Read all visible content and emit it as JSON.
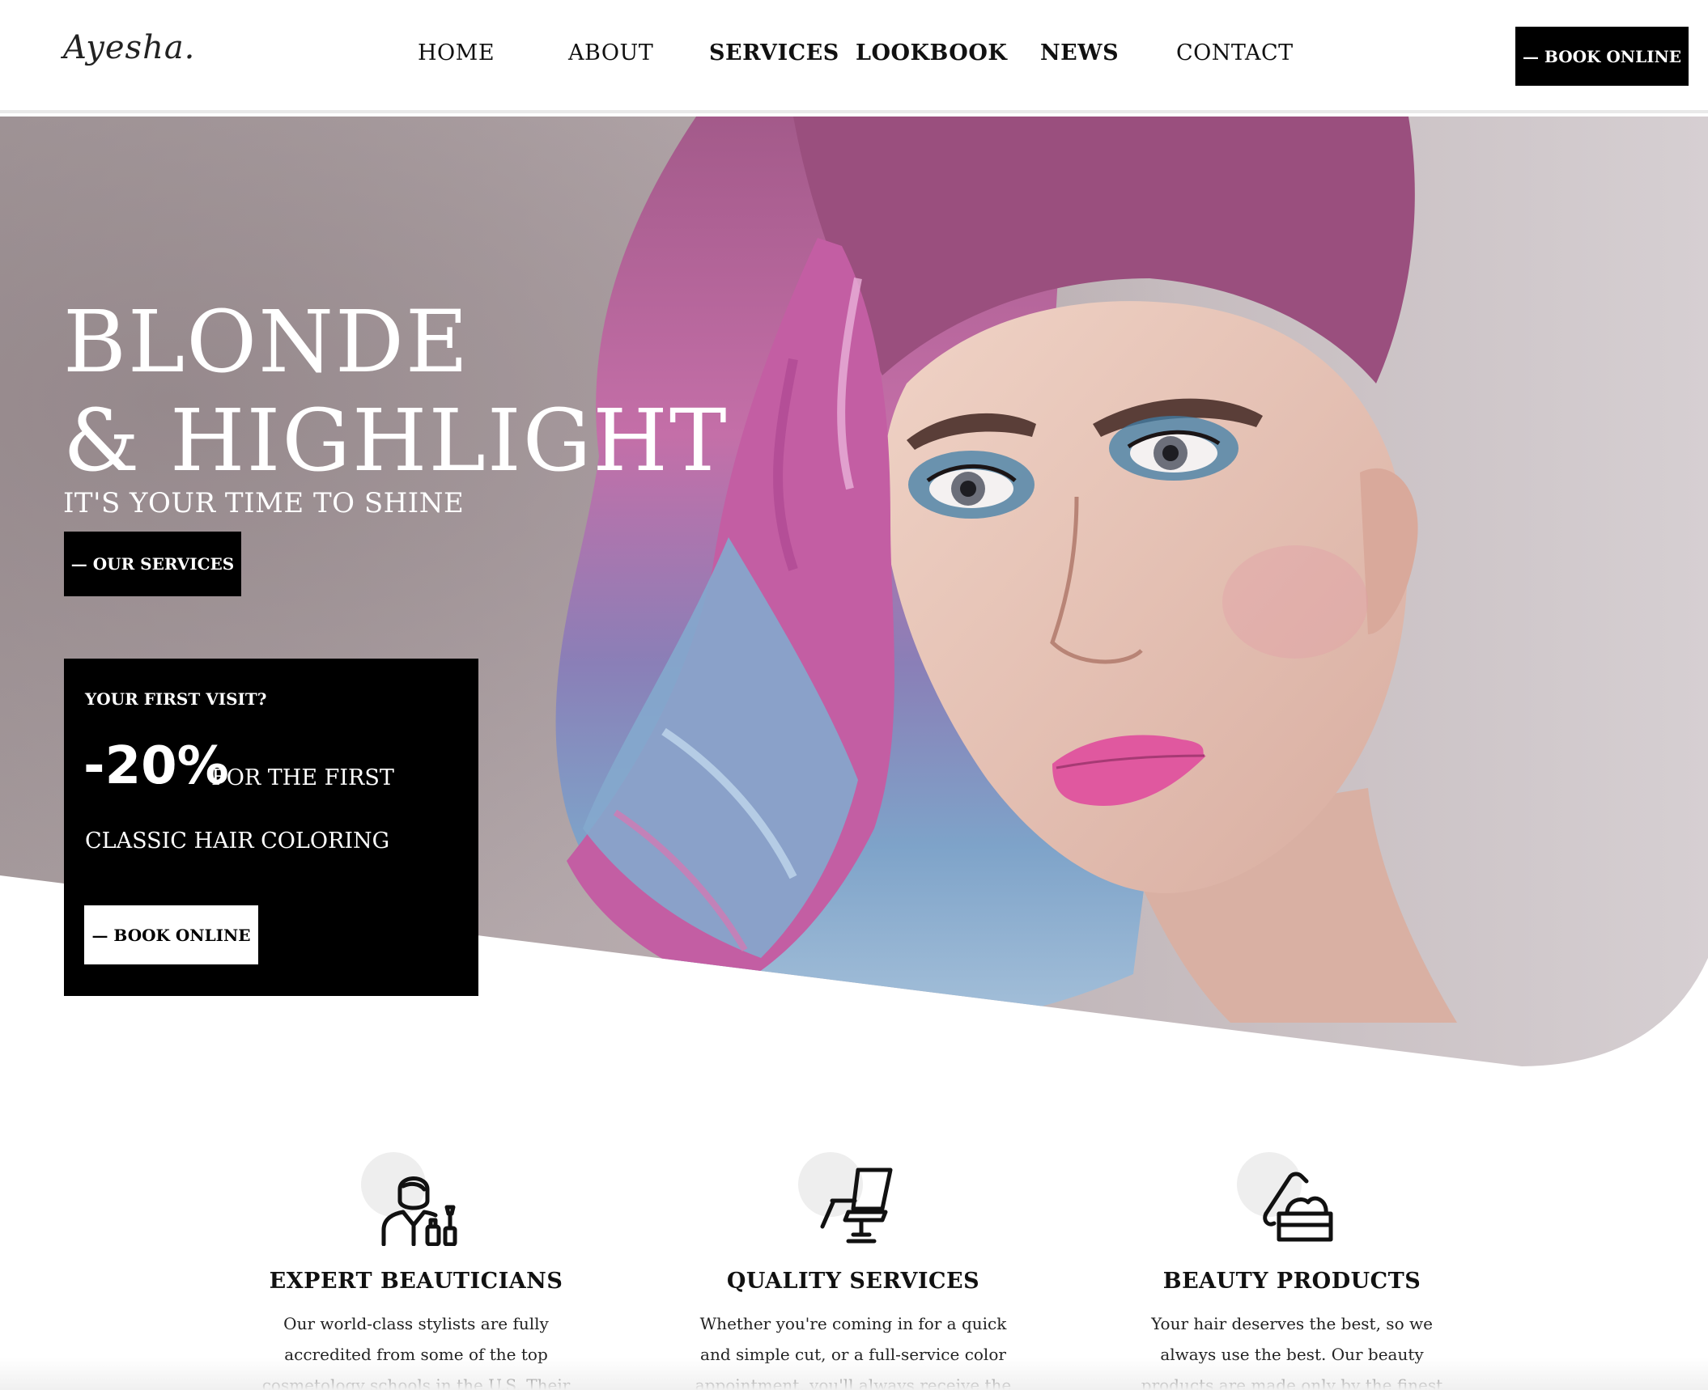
{
  "brand": {
    "logo": "Ayesha."
  },
  "nav": {
    "home": "HOME",
    "about": "ABOUT",
    "services": "SERVICES",
    "lookbook": "LOOKBOOK",
    "news": "NEWS",
    "contact": "CONTACT"
  },
  "header": {
    "book_label": "— BOOK ONLINE"
  },
  "hero": {
    "title_line1": "BLONDE",
    "title_line2": "& HIGHLIGHT",
    "subtitle": "IT'S YOUR TIME TO SHINE",
    "services_button": "— OUR SERVICES"
  },
  "promo": {
    "question": "YOUR FIRST VISIT?",
    "discount": "-20%",
    "discount_text": "FOR THE FIRST",
    "line2": "CLASSIC HAIR COLORING",
    "button": "— BOOK ONLINE"
  },
  "features": [
    {
      "icon": "beautician-icon",
      "title": "EXPERT BEAUTICIANS",
      "text": "Our world-class stylists are fully accredited from some of the top cosmetology schools in the U.S. Their skills are matched only by their"
    },
    {
      "icon": "salon-chair-icon",
      "title": "QUALITY SERVICES",
      "text": "Whether you're coming in for a quick and simple cut, or a full-service color appointment, you'll always receive the best"
    },
    {
      "icon": "beauty-products-icon",
      "title": "BEAUTY PRODUCTS",
      "text": "Your hair deserves the best, so we always use the best. Our beauty products are made only by the finest brands in the world — and we"
    }
  ],
  "colors": {
    "accent": "#000000",
    "hero_bg": "#b9adb1",
    "hair_pink": "#c0529a",
    "hair_blue": "#7fa2c8",
    "lips": "#e0589f"
  }
}
